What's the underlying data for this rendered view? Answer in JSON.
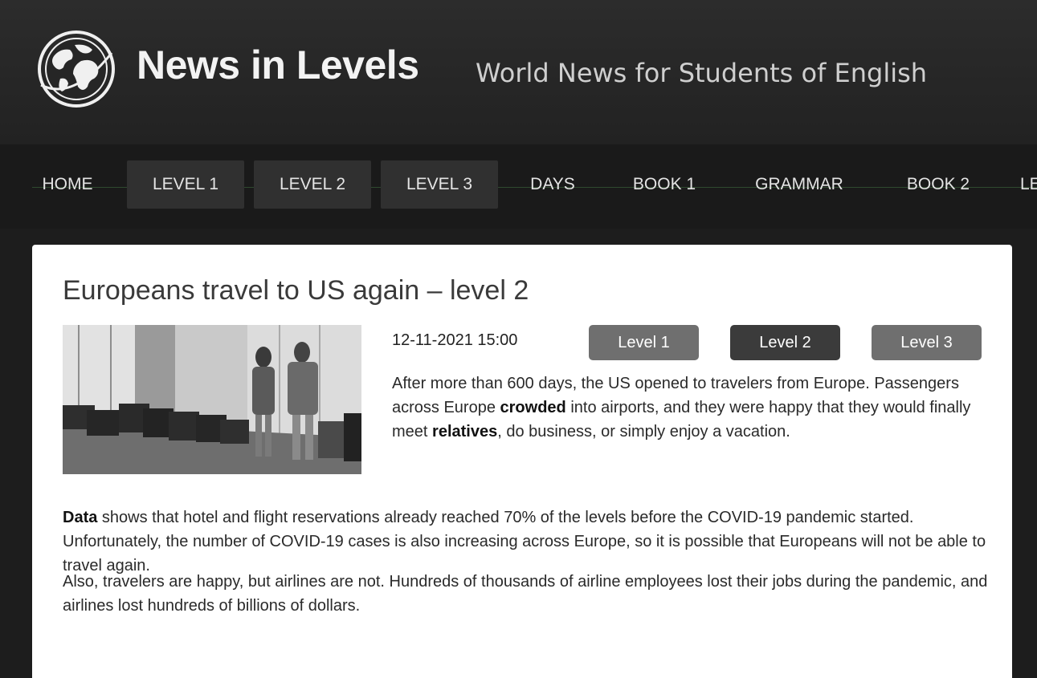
{
  "site": {
    "title": "News in Levels",
    "tagline": "World News for Students of English"
  },
  "nav": {
    "items": [
      "HOME",
      "LEVEL 1",
      "LEVEL 2",
      "LEVEL 3",
      "DAYS",
      "BOOK 1",
      "GRAMMAR",
      "BOOK 2",
      "LE"
    ]
  },
  "article": {
    "title": "Europeans travel to US again – level 2",
    "date": "12-11-2021 15:00",
    "levels": [
      "Level 1",
      "Level 2",
      "Level 3"
    ],
    "current_level": "Level 2",
    "paragraph1": [
      {
        "text": "After more than 600 days, the US opened to travelers from Europe. Passengers across Europe ",
        "bold": false
      },
      {
        "text": "crowded",
        "bold": true
      },
      {
        "text": " into airports, and they were happy that they would finally meet ",
        "bold": false
      },
      {
        "text": "relatives",
        "bold": true
      },
      {
        "text": ", do business, or simply enjoy a vacation.",
        "bold": false
      }
    ],
    "paragraph2": [
      {
        "text": "Data",
        "bold": true
      },
      {
        "text": " shows that hotel and flight reservations already reached 70% of the levels before the COVID-19 pandemic started. Unfortunately, the number of COVID-19 cases is also increasing across Europe, so it is possible that Europeans will not be able to travel again.",
        "bold": false
      }
    ],
    "paragraph3": [
      {
        "text": "Also, travelers are happy, but airlines are not. Hundreds of thousands of airline employees lost their jobs during the pandemic, and airlines lost hundreds of billions of dollars.",
        "bold": false
      }
    ]
  },
  "colors": {
    "header_bg": "#262626",
    "nav_bg": "#1a1a1a",
    "nav_active_bg": "#303030",
    "level_btn": "#6f6f6f",
    "level_btn_active": "#3b3b3b"
  },
  "icons": {
    "logo": "globe-icon"
  }
}
